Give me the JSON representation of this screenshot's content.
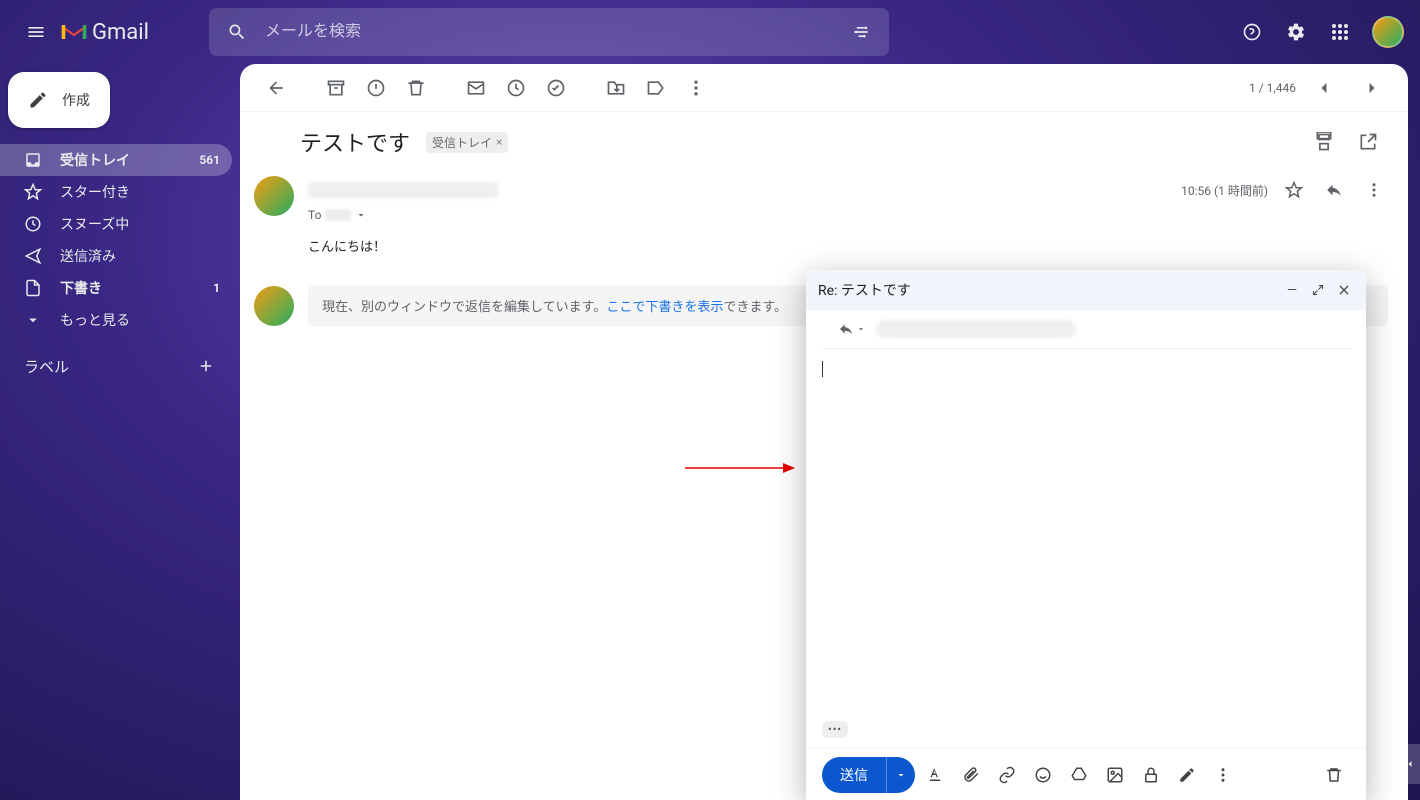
{
  "header": {
    "app_name": "Gmail",
    "search_placeholder": "メールを検索"
  },
  "compose_label": "作成",
  "nav": {
    "inbox": {
      "label": "受信トレイ",
      "count": "561"
    },
    "starred": {
      "label": "スター付き"
    },
    "snoozed": {
      "label": "スヌーズ中"
    },
    "sent": {
      "label": "送信済み"
    },
    "drafts": {
      "label": "下書き",
      "count": "1"
    },
    "more": {
      "label": "もっと見る"
    }
  },
  "labels_header": "ラベル",
  "toolbar": {
    "pagination": "1 / 1,446"
  },
  "email": {
    "subject": "テストです",
    "label_chip": "受信トレイ",
    "to_prefix": "To",
    "timestamp": "10:56 (1 時間前)",
    "body": "こんにちは！",
    "notice_prefix": "現在、別のウィンドウで返信を編集しています。",
    "notice_link": "ここで下書きを表示",
    "notice_suffix": "できます。"
  },
  "compose": {
    "title": "Re: テストです",
    "send_label": "送信",
    "trimmed": "•••"
  }
}
